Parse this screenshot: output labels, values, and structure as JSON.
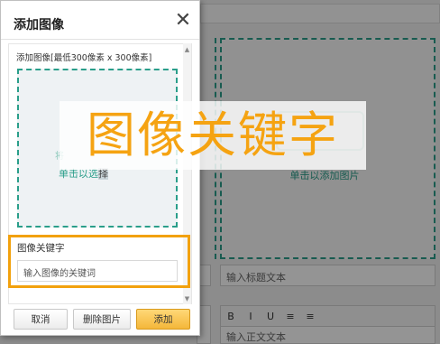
{
  "background": {
    "drop_text": "单击以添加图片",
    "title_placeholder": "输入标题文本",
    "body_placeholder": "输入正文文本",
    "toolbar": [
      "B",
      "I",
      "U",
      "≡",
      "≡"
    ]
  },
  "dialog": {
    "title": "添加图像",
    "close_label": "✕",
    "add_image_label": "添加图像[最低300像素 x 300像素]",
    "drop_hint": "将",
    "drop_button_text": "单击以选",
    "drop_button_highlight": "择",
    "keyword_label": "图像关键字",
    "keyword_placeholder": "输入图像的关键词",
    "buttons": {
      "cancel": "取消",
      "delete": "删除图片",
      "add": "添加"
    }
  },
  "caption": "图像关键字",
  "colors": {
    "accent": "#f5a312",
    "teal": "#2a9e8a",
    "highlight_box": "#f2a10d"
  }
}
